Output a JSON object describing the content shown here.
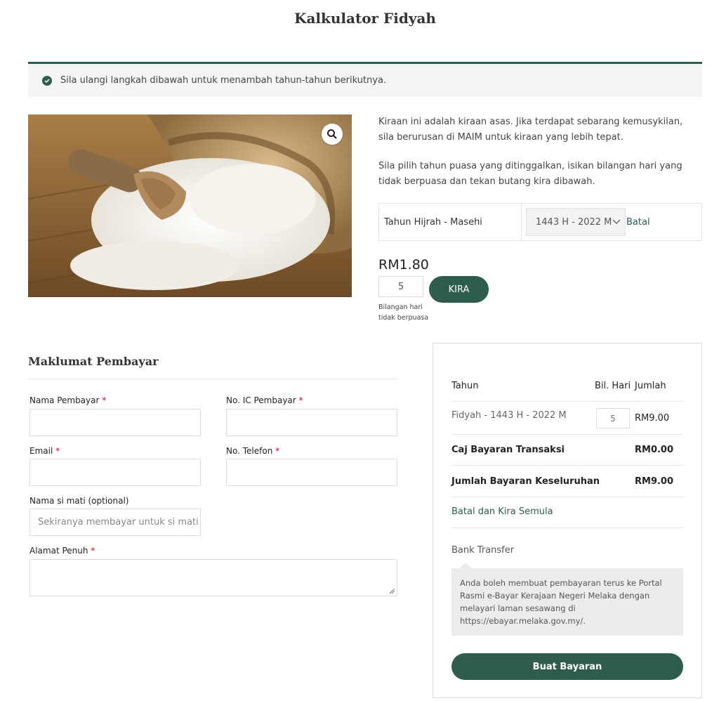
{
  "page": {
    "title": "Kalkulator Fidyah"
  },
  "notice": {
    "text": "Sila ulangi langkah dibawah untuk menambah tahun-tahun berikutnya."
  },
  "description": {
    "para1": "Kiraan ini adalah kiraan asas. Jika terdapat sebarang kemusykilan, sila berurusan di MAIM untuk kiraan yang lebih tepat.",
    "para2": "Sila pilih tahun puasa yang ditinggalkan, isikan bilangan hari yang tidak berpuasa dan tekan butang kira dibawah."
  },
  "year_selector": {
    "label": "Tahun Hijrah - Masehi",
    "selected": "1443 H - 2022 M",
    "reset_link": "Batal"
  },
  "calculator": {
    "price": "RM1.80",
    "days_value": "5",
    "kira_button": "KIRA",
    "days_hint": "Bilangan hari tidak berpuasa"
  },
  "payer_form": {
    "title": "Maklumat Pembayar",
    "required_mark": "*",
    "name_label": "Nama Pembayar",
    "ic_label": "No. IC Pembayar",
    "email_label": "Email",
    "phone_label": "No. Telefon",
    "deceased_label": "Nama si mati (optional)",
    "deceased_placeholder": "Sekiranya membayar untuk si mati",
    "address_label": "Alamat Penuh"
  },
  "summary": {
    "col_year": "Tahun",
    "col_days": "Bil. Hari",
    "col_amount": "Jumlah",
    "item_label": "Fidyah - 1443 H - 2022 M",
    "item_days": "5",
    "item_amount": "RM9.00",
    "fee_label": "Caj Bayaran Transaksi",
    "fee_amount": "RM0.00",
    "total_label": "Jumlah Bayaran Keseluruhan",
    "total_amount": "RM9.00",
    "reset_link": "Batal dan Kira Semula",
    "payment_method": "Bank Transfer",
    "payment_note": "Anda boleh membuat pembayaran terus ke Portal Rasmi e-Bayar Kerajaan Negeri Melaka dengan melayari laman sesawang di https://ebayar.melaka.gov.my/.",
    "pay_button": "Buat Bayaran"
  },
  "colors": {
    "accent": "#2f5d4c",
    "required": "#d0021b"
  },
  "icons": {
    "notice": "check-circle-icon",
    "zoom": "magnifier-icon",
    "select": "chevron-down-icon",
    "textarea": "resize-handle-icon"
  }
}
